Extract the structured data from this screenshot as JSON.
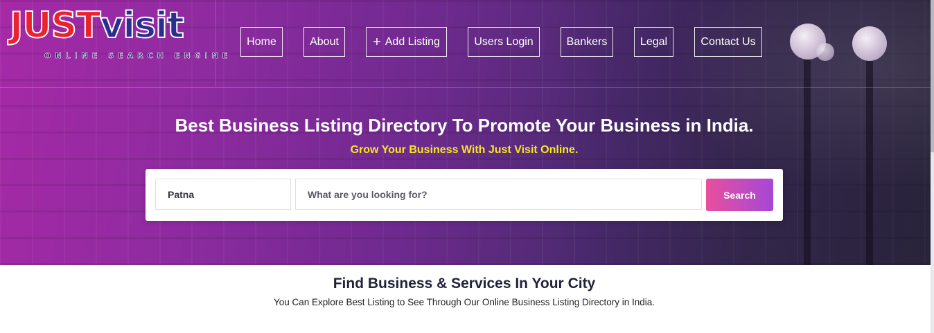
{
  "logo": {
    "brand_left": "JUST",
    "brand_right": "visit",
    "tagline": "ONLINE SEARCH ENGINE"
  },
  "nav": {
    "home": "Home",
    "about": "About",
    "add_listing": "Add Listing",
    "add_icon": "+",
    "users_login": "Users Login",
    "bankers": "Bankers",
    "legal": "Legal",
    "contact": "Contact Us"
  },
  "hero": {
    "title": "Best Business Listing Directory To Promote Your Business in India.",
    "subtitle": "Grow Your Business With Just Visit Online."
  },
  "search": {
    "city_value": "Patna",
    "query_placeholder": "What are you looking for?",
    "button_label": "Search"
  },
  "section": {
    "title": "Find Business & Services In Your City",
    "subtitle": "You Can Explore Best Listing to See Through Our Online Business Listing Directory in India."
  },
  "colors": {
    "accent_pink": "#e84f9d",
    "accent_purple": "#a548d8",
    "subtitle_yellow": "#f6e91c",
    "logo_red": "#e8232f",
    "logo_blue": "#2a2f8f"
  }
}
